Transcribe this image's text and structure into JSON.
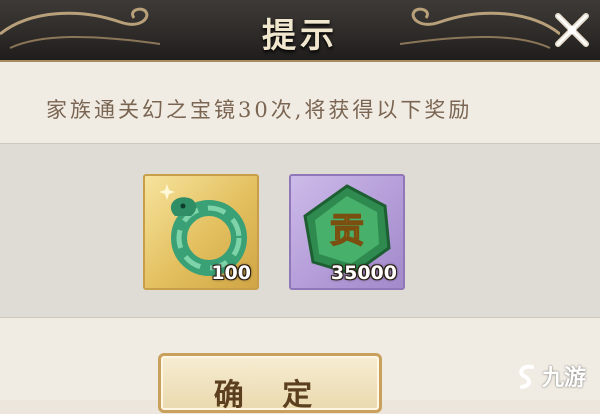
{
  "dialog": {
    "title": "提示",
    "close_icon": "close-x-icon",
    "message": "家族通关幻之宝镜30次,将获得以下奖励",
    "confirm_label": "确 定"
  },
  "rewards": [
    {
      "icon": "jade-dragon-ring-icon",
      "quantity": "100",
      "frame": "gold"
    },
    {
      "icon": "contribution-token-icon",
      "token_text": "贡",
      "quantity": "35000",
      "frame": "purple"
    }
  ],
  "watermark": {
    "text": "九游",
    "icon": "jiuyou-logo-icon"
  },
  "colors": {
    "header": "#2d2a28",
    "panel": "#f1ece3",
    "strip": "#dfdbd5",
    "gold_frame": "#e3bf5e",
    "purple_frame": "#b29ad7",
    "message_text": "#7a6552"
  }
}
